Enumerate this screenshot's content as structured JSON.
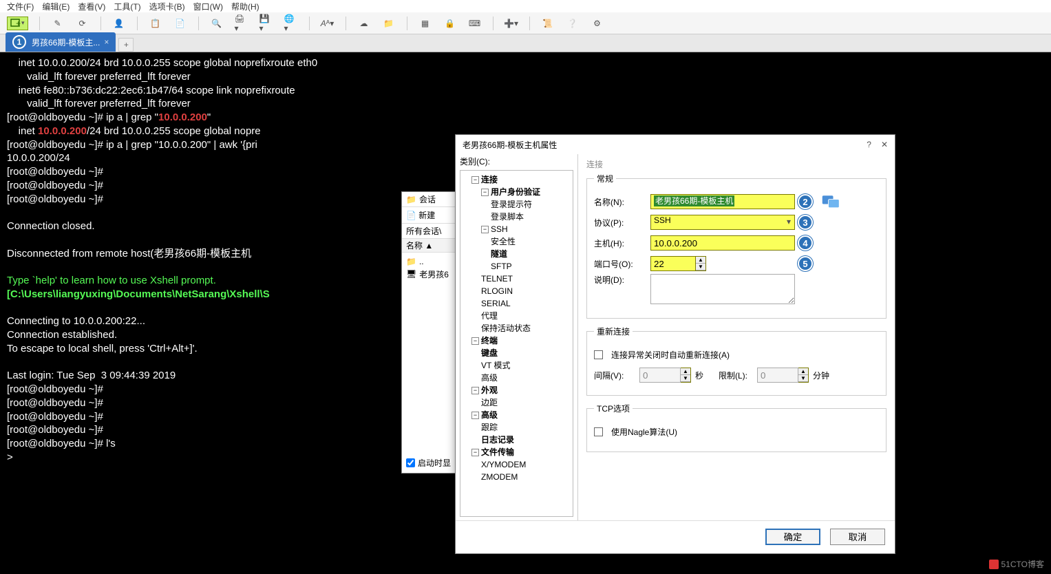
{
  "menubar": [
    "文件(F)",
    "编辑(E)",
    "查看(V)",
    "工具(T)",
    "选项卡(B)",
    "窗口(W)",
    "帮助(H)"
  ],
  "tab": {
    "title": "男孩66期-模板主...",
    "badge": "1"
  },
  "terminal": {
    "l1": "    inet 10.0.0.200/24 brd 10.0.0.255 scope global noprefixroute eth0",
    "l2": "       valid_lft forever preferred_lft forever",
    "l3": "    inet6 fe80::b736:dc22:2ec6:1b47/64 scope link noprefixroute",
    "l4": "       valid_lft forever preferred_lft forever",
    "l5a": "[root@oldboyedu ~]# ip a | grep \"",
    "l5b": "10.0.0.200",
    "l5c": "\"",
    "l6a": "    inet ",
    "l6b": "10.0.0.200",
    "l6c": "/24 brd 10.0.0.255 scope global nopre",
    "l7": "[root@oldboyedu ~]# ip a | grep \"10.0.0.200\" | awk '{pri",
    "l8": "10.0.0.200/24",
    "l9": "[root@oldboyedu ~]#",
    "l10": "[root@oldboyedu ~]#",
    "l11": "[root@oldboyedu ~]#",
    "l12": "",
    "l13": "Connection closed.",
    "l14": "",
    "l15": "Disconnected from remote host(老男孩66期-模板主机",
    "l16": "",
    "l17": "Type `help' to learn how to use Xshell prompt.",
    "l18": "[C:\\Users\\liangyuxing\\Documents\\NetSarang\\Xshell\\S",
    "l19": "",
    "l20": "Connecting to 10.0.0.200:22...",
    "l21": "Connection established.",
    "l22": "To escape to local shell, press 'Ctrl+Alt+]'.",
    "l23": "",
    "l24": "Last login: Tue Sep  3 09:44:39 2019",
    "l25": "[root@oldboyedu ~]#",
    "l26": "[root@oldboyedu ~]#",
    "l27": "[root@oldboyedu ~]#",
    "l28": "[root@oldboyedu ~]#",
    "l29": "[root@oldboyedu ~]# l's",
    "l30": ">"
  },
  "sessions": {
    "title": "会话",
    "new": "新建",
    "allsessions": "所有会话\\",
    "col": "名称 ▲",
    "items": [
      "..",
      "老男孩6"
    ],
    "startup": "启动时显"
  },
  "dialog": {
    "title": "老男孩66期-模板主机属性",
    "category": "类别(C):",
    "sectionTitle": "连接",
    "tree": {
      "connection": "连接",
      "auth": "用户身份验证",
      "loginPrompt": "登录提示符",
      "loginScript": "登录脚本",
      "ssh": "SSH",
      "security": "安全性",
      "tunnel": "隧道",
      "sftp": "SFTP",
      "telnet": "TELNET",
      "rlogin": "RLOGIN",
      "serial": "SERIAL",
      "proxy": "代理",
      "keepalive": "保持活动状态",
      "terminal": "终端",
      "keyboard": "键盘",
      "vtmode": "VT 模式",
      "advanced": "高级",
      "appearance": "外观",
      "margin": "边距",
      "advanced2": "高级",
      "trace": "跟踪",
      "logging": "日志记录",
      "filetransfer": "文件传输",
      "xymodem": "X/YMODEM",
      "zmodem": "ZMODEM"
    },
    "general": {
      "legend": "常规",
      "nameLabel": "名称(N):",
      "nameValue": "老男孩66期-模板主机",
      "protocolLabel": "协议(P):",
      "protocolValue": "SSH",
      "hostLabel": "主机(H):",
      "hostValue": "10.0.0.200",
      "portLabel": "端口号(O):",
      "portValue": "22",
      "descLabel": "说明(D):"
    },
    "reconnect": {
      "legend": "重新连接",
      "autoReconnect": "连接异常关闭时自动重新连接(A)",
      "intervalLabel": "间隔(V):",
      "intervalValue": "0",
      "intervalUnit": "秒",
      "limitLabel": "限制(L):",
      "limitValue": "0",
      "limitUnit": "分钟"
    },
    "tcp": {
      "legend": "TCP选项",
      "nagle": "使用Nagle算法(U)"
    },
    "ok": "确定",
    "cancel": "取消"
  },
  "badges": {
    "b2": "2",
    "b3": "3",
    "b4": "4",
    "b5": "5"
  },
  "watermark": "51CTO博客"
}
